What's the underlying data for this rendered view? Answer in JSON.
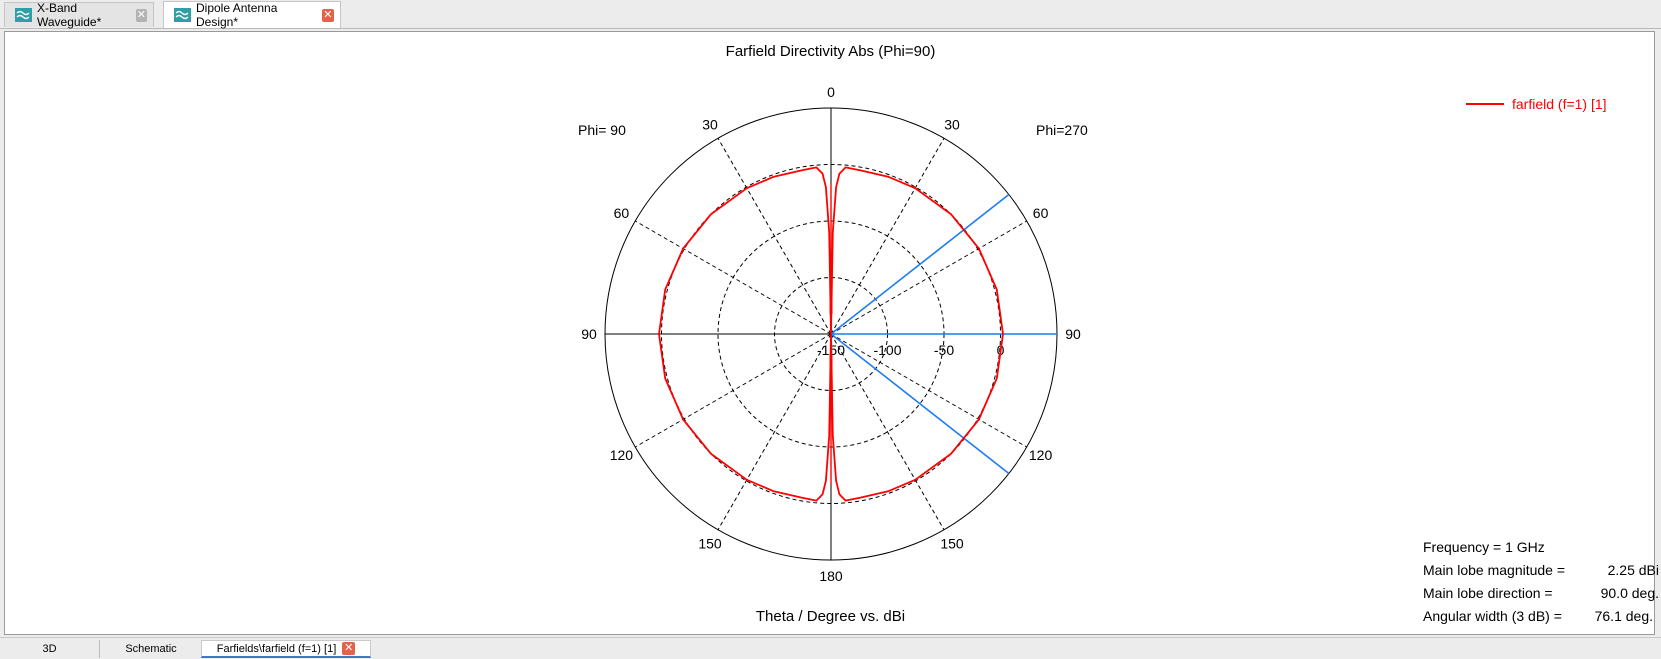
{
  "document_tabs": [
    {
      "label": "X-Band Waveguide*",
      "icon": "waveguide-icon",
      "active": false
    },
    {
      "label": "Dipole Antenna Design*",
      "icon": "waveguide-icon",
      "active": true
    }
  ],
  "view_tabs": [
    {
      "label": "3D",
      "active": false
    },
    {
      "label": "Schematic",
      "active": false
    },
    {
      "label": "Farfields\\farfield (f=1) [1]",
      "active": true
    }
  ],
  "plot": {
    "phi_left_label": "Phi= 90",
    "phi_right_label": "Phi=270",
    "legend_label": "farfield (f=1) [1]",
    "legend_color": "#ff0000",
    "beam_color": "#1a7cf2",
    "info": {
      "frequency": "Frequency = 1 GHz",
      "main_lobe_magnitude_label": "Main lobe magnitude =",
      "main_lobe_magnitude_value": "2.25 dBi",
      "main_lobe_direction_label": "Main lobe direction =",
      "main_lobe_direction_value": "90.0 deg.",
      "angular_width_label": "Angular width (3 dB) =",
      "angular_width_value": "76.1 deg."
    }
  },
  "chart_data": {
    "type": "polar",
    "title": "Farfield Directivity Abs (Phi=90)",
    "xlabel": "Theta / Degree vs. dBi",
    "radial_ticks": [
      -150,
      -100,
      -50,
      0
    ],
    "radial_range": [
      -150,
      50
    ],
    "angle_ticks_right": [
      "0",
      "30",
      "60",
      "90",
      "120",
      "150",
      "180"
    ],
    "angle_ticks_left": [
      "30",
      "60",
      "90",
      "120",
      "150"
    ],
    "series": [
      {
        "name": "farfield (f=1) [1]",
        "color": "#ff0000",
        "theta_deg": [
          0,
          1,
          2,
          3,
          5,
          10,
          20,
          30,
          45,
          60,
          75,
          90,
          105,
          120,
          135,
          150,
          160,
          170,
          175,
          177,
          178,
          179,
          180
        ],
        "dbi": [
          -150,
          -60,
          -20,
          -8,
          -2,
          -2.8,
          -1.9,
          -1.0,
          0.0,
          1.1,
          1.9,
          2.25,
          1.9,
          1.1,
          0.0,
          -1.0,
          -1.9,
          -2.8,
          -2,
          -8,
          -20,
          -60,
          -150
        ]
      }
    ],
    "beam_lines_deg": [
      51.9,
      90,
      128.1
    ],
    "main_lobe_deg": 90
  }
}
